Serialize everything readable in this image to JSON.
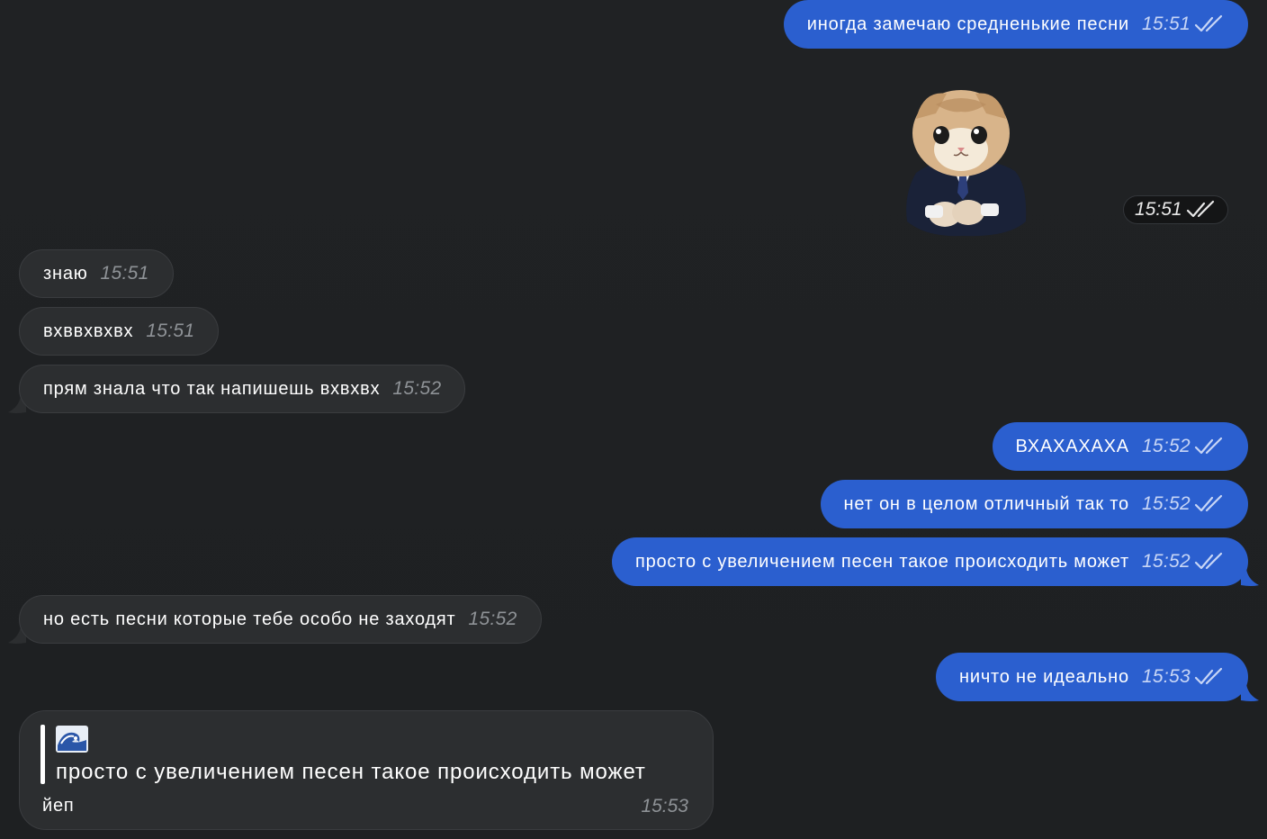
{
  "messages": {
    "m1": {
      "text": "иногда замечаю средненькие песни",
      "time": "15:51"
    },
    "sticker": {
      "time": "15:51",
      "icon": "cat-in-suit-sticker"
    },
    "m2": {
      "text": "знаю",
      "time": "15:51"
    },
    "m3": {
      "text": "вхввхвхвх",
      "time": "15:51"
    },
    "m4": {
      "text": "прям знала что так напишешь вхвхвх",
      "time": "15:52"
    },
    "m5": {
      "text": "ВХАХАХАХА",
      "time": "15:52"
    },
    "m6": {
      "text": "нет он в целом отличный так то",
      "time": "15:52"
    },
    "m7": {
      "text": "просто с увеличением песен такое происходить может",
      "time": "15:52"
    },
    "m8": {
      "text": "но есть песни которые тебе особо не заходят",
      "time": "15:52"
    },
    "m9": {
      "text": "ничто не идеально",
      "time": "15:53"
    },
    "m10": {
      "reply_icon": "wave-emoji",
      "reply_quote": "просто с увеличением песен такое происходить может",
      "text": "йеп",
      "time": "15:53"
    }
  },
  "colors": {
    "outgoing": "#2b5fcf",
    "incoming": "#2c2e30",
    "background": "#1f2123"
  }
}
